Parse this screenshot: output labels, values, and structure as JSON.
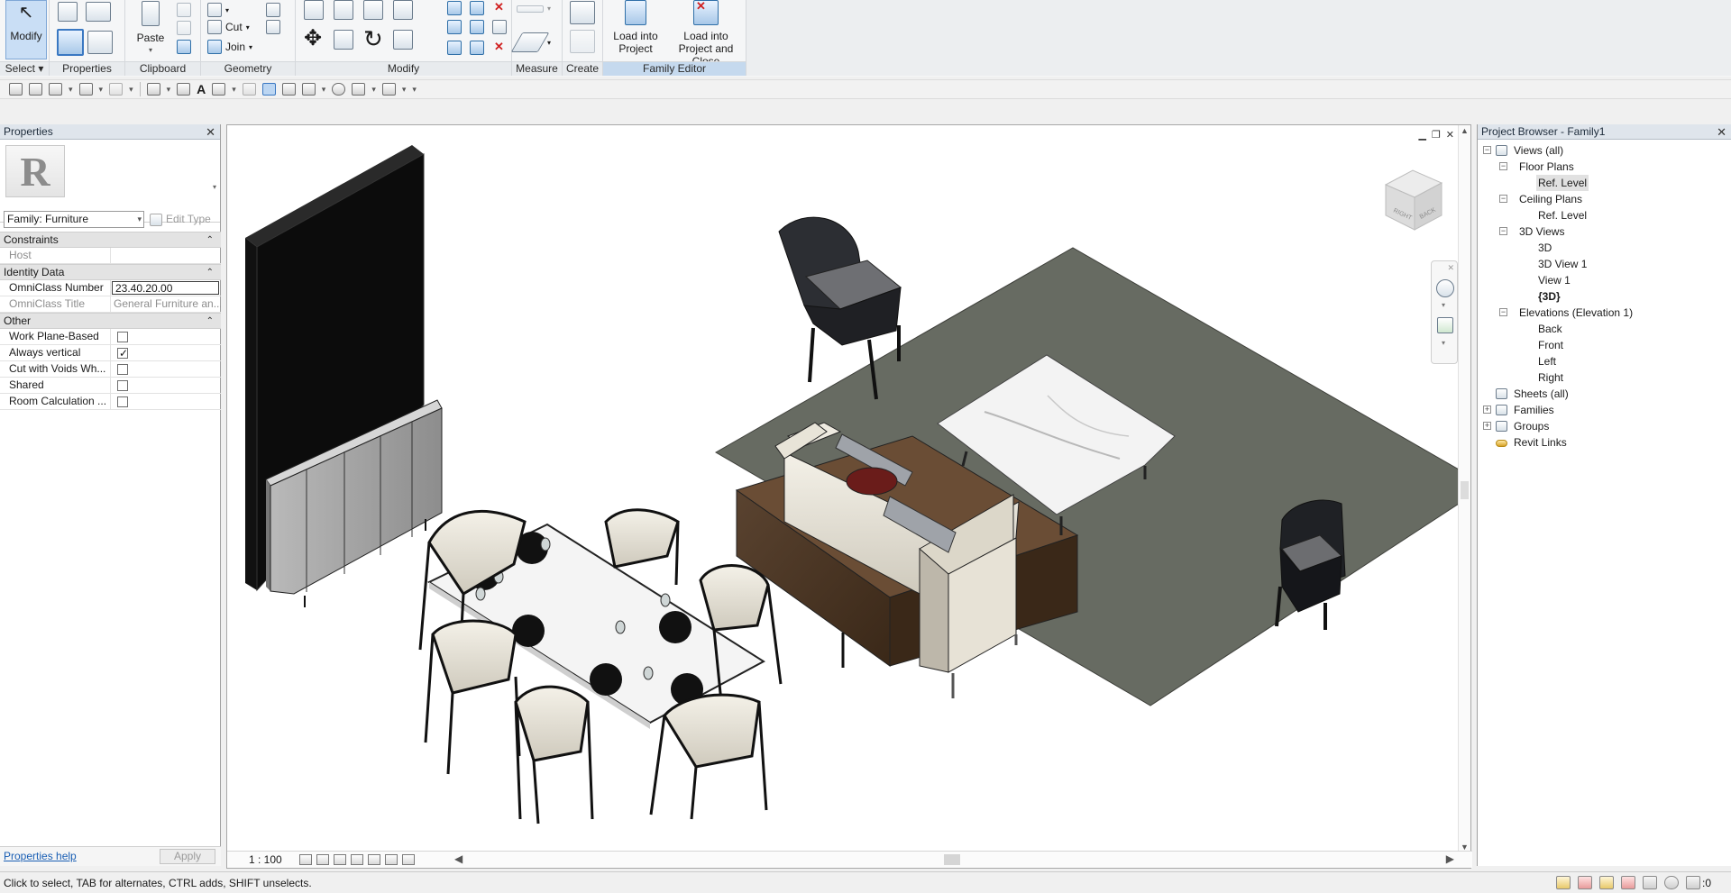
{
  "ribbon": {
    "panels": {
      "select": "Select",
      "properties": "Properties",
      "clipboard": "Clipboard",
      "geometry": "Geometry",
      "modify": "Modify",
      "measure": "Measure",
      "create": "Create",
      "family_editor": "Family Editor"
    },
    "modify_button": "Modify",
    "paste_button": "Paste",
    "cut_button": "Cut",
    "join_button": "Join",
    "load_into_project": [
      "Load into",
      "Project"
    ],
    "load_into_project_close": [
      "Load into",
      "Project and Close"
    ]
  },
  "properties": {
    "title": "Properties",
    "logo_letter": "R",
    "family_selector": "Family: Furniture",
    "edit_type": "Edit Type",
    "groups": {
      "constraints": "Constraints",
      "identity": "Identity Data",
      "other": "Other"
    },
    "rows": {
      "host": {
        "label": "Host",
        "value": ""
      },
      "omniclass_number": {
        "label": "OmniClass Number",
        "value": "23.40.20.00"
      },
      "omniclass_title": {
        "label": "OmniClass Title",
        "value": "General Furniture an..."
      },
      "work_plane_based": {
        "label": "Work Plane-Based",
        "checked": false
      },
      "always_vertical": {
        "label": "Always vertical",
        "checked": true
      },
      "cut_with_voids": {
        "label": "Cut with Voids Wh...",
        "checked": false
      },
      "shared": {
        "label": "Shared",
        "checked": false
      },
      "room_calc": {
        "label": "Room Calculation ...",
        "checked": false
      }
    },
    "help_link": "Properties help",
    "apply_button": "Apply"
  },
  "view": {
    "scale": "1 : 100",
    "viewcube": {
      "right": "RIGHT",
      "back": "BACK"
    }
  },
  "project_browser": {
    "title": "Project Browser - Family1",
    "tree": {
      "views_all": "Views (all)",
      "floor_plans": "Floor Plans",
      "fp_ref_level": "Ref. Level",
      "ceiling_plans": "Ceiling Plans",
      "cp_ref_level": "Ref. Level",
      "views_3d": "3D Views",
      "v3d": "3D",
      "v3d_view1": "3D View 1",
      "view1": "View 1",
      "v3d_current": "{3D}",
      "elevations": "Elevations (Elevation 1)",
      "back": "Back",
      "front": "Front",
      "left": "Left",
      "right": "Right",
      "sheets": "Sheets (all)",
      "families": "Families",
      "groups": "Groups",
      "revit_links": "Revit Links"
    }
  },
  "status": {
    "text": "Click to select, TAB for alternates, CTRL adds, SHIFT unselects.",
    "filter_count": ":0"
  },
  "colors": {
    "accent": "#c9def5",
    "rug": "#666a62",
    "wood": "#4a3423",
    "marble": "#f3f3f3",
    "link": "#1a5fb4"
  }
}
